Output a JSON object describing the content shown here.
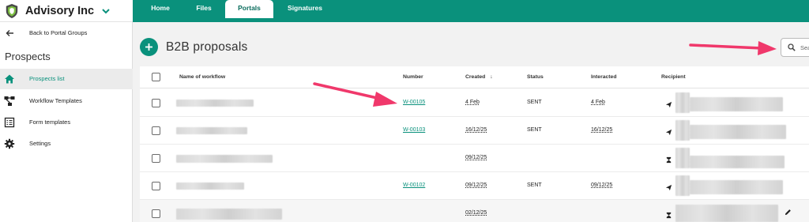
{
  "brand": {
    "name": "Advisory Inc"
  },
  "topnav": {
    "tabs": [
      {
        "label": "Home",
        "active": false
      },
      {
        "label": "Files",
        "active": false
      },
      {
        "label": "Portals",
        "active": true
      },
      {
        "label": "Signatures",
        "active": false
      }
    ]
  },
  "sidebar": {
    "back_label": "Back to Portal Groups",
    "section_title": "Prospects",
    "items": [
      {
        "label": "Prospects list",
        "icon": "home-icon",
        "active": true
      },
      {
        "label": "Workflow Templates",
        "icon": "workflow-icon",
        "active": false
      },
      {
        "label": "Form templates",
        "icon": "form-icon",
        "active": false
      },
      {
        "label": "Settings",
        "icon": "gear-icon",
        "active": false
      }
    ]
  },
  "main": {
    "title": "B2B proposals",
    "search_placeholder": "Sea"
  },
  "table": {
    "headers": {
      "name": "Name of workflow",
      "number": "Number",
      "created": "Created",
      "created_sort": "↓",
      "status": "Status",
      "interacted": "Interacted",
      "recipient": "Recipient"
    },
    "rows": [
      {
        "number": "W-00105",
        "created": "4 Feb",
        "status": "SENT",
        "interacted": "4 Feb",
        "recipient_icon": "send-icon"
      },
      {
        "number": "W-00103",
        "created": "16/12/25",
        "status": "SENT",
        "interacted": "16/12/25",
        "recipient_icon": "send-icon"
      },
      {
        "number": "",
        "created": "09/12/25",
        "status": "",
        "interacted": "",
        "recipient_icon": "hourglass-icon"
      },
      {
        "number": "W-00102",
        "created": "09/12/25",
        "status": "SENT",
        "interacted": "09/12/25",
        "recipient_icon": "send-icon"
      },
      {
        "number": "",
        "created": "02/12/25",
        "status": "",
        "interacted": "",
        "recipient_icon": "hourglass-icon"
      }
    ]
  },
  "colors": {
    "accent": "#0a917c",
    "annotation_arrow": "#f0386b"
  }
}
